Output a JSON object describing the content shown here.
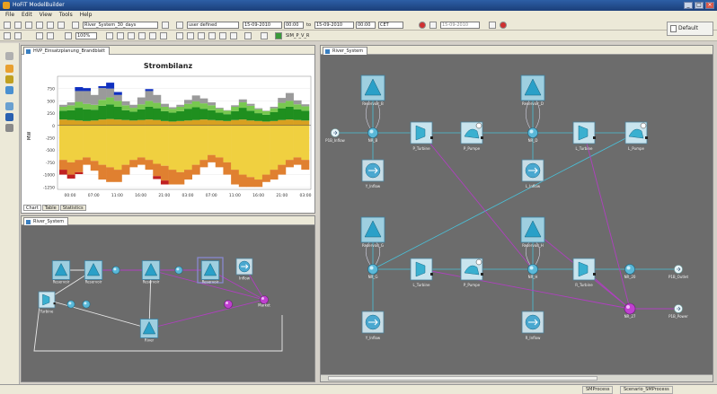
{
  "window": {
    "title": "HoFiT ModelBuilder"
  },
  "menu": [
    "File",
    "Edit",
    "View",
    "Tools",
    "Help"
  ],
  "toolbar": {
    "model_field": "River_System_30_days",
    "profile_field": "user defined",
    "date_from": "15-09-2010",
    "time_from": "00:00",
    "to_label": "to",
    "date_to": "15-09-2010",
    "time_to": "00:00",
    "tz": "CET",
    "extra_field": "15-09-2010",
    "zoom": "100%",
    "sim_label": "SIM_P_V_R"
  },
  "perspective": {
    "label": "Default"
  },
  "chart_panel": {
    "tab": "HVP_Einsatzplanung_Brandblatt",
    "subtabs": [
      "Chart",
      "Table",
      "Statistics"
    ]
  },
  "chart_data": {
    "type": "area",
    "title": "Strombilanz",
    "ylabel": "MW",
    "ylim": [
      -1300,
      1000
    ],
    "y_ticks": [
      750,
      500,
      250,
      0,
      -250,
      -500,
      -750,
      -1000,
      -1250
    ],
    "x_ticks": [
      "00:00",
      "07:00",
      "11:00",
      "16:00",
      "21:00",
      "03:00",
      "07:00",
      "11:00",
      "16:00",
      "21:00",
      "03:00"
    ],
    "positive_series": [
      {
        "color": "#d8a020",
        "values": [
          120,
          110,
          100,
          90,
          100,
          120,
          130,
          120,
          110,
          100,
          110,
          120,
          110,
          90,
          80,
          90,
          100,
          110,
          120,
          110,
          100,
          90,
          110,
          120,
          100,
          90,
          80,
          90,
          110,
          120,
          110,
          100
        ]
      },
      {
        "color": "#1f8f1f",
        "values": [
          180,
          200,
          260,
          240,
          220,
          280,
          300,
          260,
          200,
          180,
          220,
          260,
          240,
          200,
          180,
          200,
          240,
          260,
          220,
          200,
          160,
          140,
          180,
          240,
          200,
          160,
          140,
          180,
          240,
          260,
          220,
          200
        ]
      },
      {
        "color": "#78c850",
        "values": [
          80,
          100,
          120,
          110,
          100,
          120,
          140,
          120,
          100,
          80,
          100,
          120,
          110,
          90,
          80,
          90,
          100,
          120,
          110,
          100,
          80,
          70,
          90,
          110,
          100,
          80,
          70,
          80,
          110,
          120,
          100,
          90
        ]
      },
      {
        "color": "#9a9a9a",
        "values": [
          40,
          60,
          220,
          260,
          200,
          240,
          180,
          120,
          80,
          60,
          140,
          200,
          160,
          60,
          30,
          40,
          80,
          120,
          100,
          60,
          20,
          10,
          30,
          60,
          40,
          20,
          10,
          30,
          100,
          160,
          80,
          40
        ]
      },
      {
        "color": "#1030c0",
        "values": [
          0,
          0,
          80,
          60,
          0,
          40,
          120,
          60,
          0,
          0,
          0,
          40,
          0,
          0,
          0,
          0,
          0,
          0,
          0,
          0,
          0,
          0,
          0,
          0,
          0,
          0,
          0,
          0,
          0,
          0,
          0,
          0
        ]
      }
    ],
    "negative_series": [
      {
        "color": "#f0d040",
        "values": [
          -700,
          -750,
          -700,
          -650,
          -720,
          -800,
          -850,
          -900,
          -800,
          -700,
          -650,
          -700,
          -780,
          -820,
          -900,
          -950,
          -900,
          -800,
          -700,
          -600,
          -650,
          -750,
          -900,
          -1000,
          -1050,
          -1100,
          -1000,
          -900,
          -800,
          -700,
          -650,
          -700
        ]
      },
      {
        "color": "#e08030",
        "values": [
          -200,
          -250,
          -250,
          -150,
          -200,
          -300,
          -300,
          -250,
          -200,
          -150,
          -150,
          -200,
          -250,
          -300,
          -300,
          -250,
          -200,
          -200,
          -150,
          -150,
          -200,
          -250,
          -300,
          -250,
          -200,
          -150,
          -150,
          -200,
          -200,
          -150,
          -150,
          -200
        ]
      },
      {
        "color": "#c02020",
        "values": [
          -100,
          -80,
          -40,
          0,
          0,
          0,
          0,
          0,
          0,
          0,
          0,
          0,
          -60,
          -80,
          0,
          0,
          0,
          0,
          0,
          0,
          0,
          0,
          0,
          0,
          0,
          0,
          0,
          0,
          0,
          0,
          0,
          0
        ]
      }
    ]
  },
  "overview_panel": {
    "tab": "River_System"
  },
  "model_panel": {
    "tab": "River_System"
  },
  "overview_nodes": [
    {
      "kind": "reservoir",
      "label": "Reservoir"
    },
    {
      "kind": "reservoir",
      "label": "Reservoir"
    },
    {
      "kind": "reservoir",
      "label": "Reservoir"
    },
    {
      "kind": "reservoir",
      "label": "Reservoir"
    },
    {
      "kind": "reservoir",
      "label": "River"
    },
    {
      "kind": "turbine",
      "label": "Turbine"
    },
    {
      "kind": "sink",
      "label": "Market"
    },
    {
      "kind": "source",
      "label": "Inflow"
    }
  ],
  "model_nodes": [
    {
      "id": "res1",
      "kind": "reservoir",
      "label": "Reservoir_B"
    },
    {
      "id": "res2",
      "kind": "reservoir",
      "label": "Reservoir_D"
    },
    {
      "id": "res3",
      "kind": "reservoir",
      "label": "Reservoir_G"
    },
    {
      "id": "res4",
      "kind": "reservoir",
      "label": "Reservoir_H"
    },
    {
      "id": "src1",
      "kind": "source",
      "label": "P1B_Inflow"
    },
    {
      "id": "j1",
      "kind": "junction",
      "label": "NR_B"
    },
    {
      "id": "j2",
      "kind": "junction",
      "label": "NR_D"
    },
    {
      "id": "j3",
      "kind": "junction",
      "label": "NR_G"
    },
    {
      "id": "j4",
      "kind": "junction",
      "label": "NR_H"
    },
    {
      "id": "j5",
      "kind": "junction",
      "label": "NR_20"
    },
    {
      "id": "t1",
      "kind": "turbine",
      "label": "P_Turbine"
    },
    {
      "id": "t2",
      "kind": "turbine",
      "label": "L_Turbine"
    },
    {
      "id": "t3",
      "kind": "turbine",
      "label": "L_Turbine"
    },
    {
      "id": "t4",
      "kind": "turbine",
      "label": "R_Turbine"
    },
    {
      "id": "p1",
      "kind": "pump",
      "label": "P_Pumpe"
    },
    {
      "id": "p2",
      "kind": "pump",
      "label": "L_Pumpe"
    },
    {
      "id": "p3",
      "kind": "pump",
      "label": "P_Pumpe"
    },
    {
      "id": "in1",
      "kind": "inflow",
      "label": "Y_Inflow"
    },
    {
      "id": "in2",
      "kind": "inflow",
      "label": "L_Inflow"
    },
    {
      "id": "in3",
      "kind": "inflow",
      "label": "Y_Inflow"
    },
    {
      "id": "in4",
      "kind": "inflow",
      "label": "R_Inflow"
    },
    {
      "id": "out1",
      "kind": "sink",
      "label": "P1B_Outlet"
    },
    {
      "id": "out2",
      "kind": "sink",
      "label": "P1B_Power"
    },
    {
      "id": "m1",
      "kind": "market",
      "label": "NR_27"
    }
  ],
  "status": {
    "left": "SMProcess",
    "right": "Scenario_SMProcess"
  }
}
